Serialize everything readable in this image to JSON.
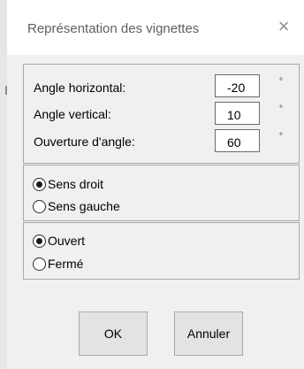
{
  "window": {
    "title": "Représentation des vignettes",
    "close_glyph": "×"
  },
  "angles": {
    "horizontal": {
      "label": "Angle horizontal:",
      "value": "-20",
      "unit": "°"
    },
    "vertical": {
      "label": "Angle vertical:",
      "value": "10",
      "unit": "°"
    },
    "opening": {
      "label": "Ouverture d'angle:",
      "value": "60",
      "unit": "°"
    }
  },
  "direction": {
    "options": [
      {
        "label": "Sens droit",
        "checked": true
      },
      {
        "label": "Sens gauche",
        "checked": false
      }
    ]
  },
  "state": {
    "options": [
      {
        "label": "Ouvert",
        "checked": true
      },
      {
        "label": "Fermé",
        "checked": false
      }
    ]
  },
  "buttons": {
    "ok": "OK",
    "cancel": "Annuler"
  }
}
